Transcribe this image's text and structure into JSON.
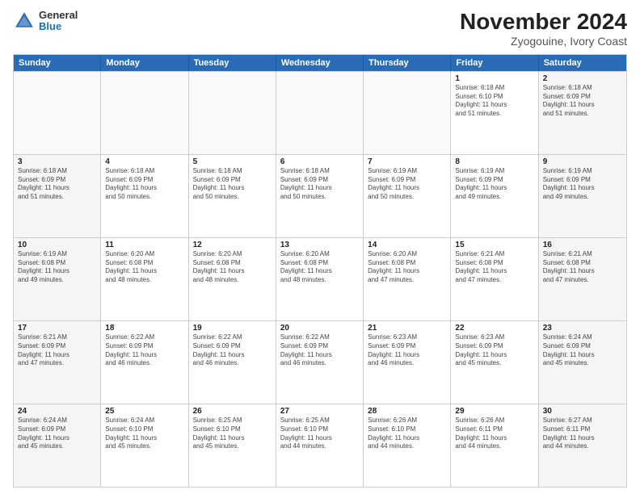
{
  "logo": {
    "general": "General",
    "blue": "Blue"
  },
  "title": "November 2024",
  "subtitle": "Zyogouine, Ivory Coast",
  "header_days": [
    "Sunday",
    "Monday",
    "Tuesday",
    "Wednesday",
    "Thursday",
    "Friday",
    "Saturday"
  ],
  "rows": [
    [
      {
        "day": "",
        "info": "",
        "empty": true
      },
      {
        "day": "",
        "info": "",
        "empty": true
      },
      {
        "day": "",
        "info": "",
        "empty": true
      },
      {
        "day": "",
        "info": "",
        "empty": true
      },
      {
        "day": "",
        "info": "",
        "empty": true
      },
      {
        "day": "1",
        "info": "Sunrise: 6:18 AM\nSunset: 6:10 PM\nDaylight: 11 hours\nand 51 minutes."
      },
      {
        "day": "2",
        "info": "Sunrise: 6:18 AM\nSunset: 6:09 PM\nDaylight: 11 hours\nand 51 minutes."
      }
    ],
    [
      {
        "day": "3",
        "info": "Sunrise: 6:18 AM\nSunset: 6:09 PM\nDaylight: 11 hours\nand 51 minutes."
      },
      {
        "day": "4",
        "info": "Sunrise: 6:18 AM\nSunset: 6:09 PM\nDaylight: 11 hours\nand 50 minutes."
      },
      {
        "day": "5",
        "info": "Sunrise: 6:18 AM\nSunset: 6:09 PM\nDaylight: 11 hours\nand 50 minutes."
      },
      {
        "day": "6",
        "info": "Sunrise: 6:18 AM\nSunset: 6:09 PM\nDaylight: 11 hours\nand 50 minutes."
      },
      {
        "day": "7",
        "info": "Sunrise: 6:19 AM\nSunset: 6:09 PM\nDaylight: 11 hours\nand 50 minutes."
      },
      {
        "day": "8",
        "info": "Sunrise: 6:19 AM\nSunset: 6:09 PM\nDaylight: 11 hours\nand 49 minutes."
      },
      {
        "day": "9",
        "info": "Sunrise: 6:19 AM\nSunset: 6:09 PM\nDaylight: 11 hours\nand 49 minutes."
      }
    ],
    [
      {
        "day": "10",
        "info": "Sunrise: 6:19 AM\nSunset: 6:08 PM\nDaylight: 11 hours\nand 49 minutes."
      },
      {
        "day": "11",
        "info": "Sunrise: 6:20 AM\nSunset: 6:08 PM\nDaylight: 11 hours\nand 48 minutes."
      },
      {
        "day": "12",
        "info": "Sunrise: 6:20 AM\nSunset: 6:08 PM\nDaylight: 11 hours\nand 48 minutes."
      },
      {
        "day": "13",
        "info": "Sunrise: 6:20 AM\nSunset: 6:08 PM\nDaylight: 11 hours\nand 48 minutes."
      },
      {
        "day": "14",
        "info": "Sunrise: 6:20 AM\nSunset: 6:08 PM\nDaylight: 11 hours\nand 47 minutes."
      },
      {
        "day": "15",
        "info": "Sunrise: 6:21 AM\nSunset: 6:08 PM\nDaylight: 11 hours\nand 47 minutes."
      },
      {
        "day": "16",
        "info": "Sunrise: 6:21 AM\nSunset: 6:08 PM\nDaylight: 11 hours\nand 47 minutes."
      }
    ],
    [
      {
        "day": "17",
        "info": "Sunrise: 6:21 AM\nSunset: 6:09 PM\nDaylight: 11 hours\nand 47 minutes."
      },
      {
        "day": "18",
        "info": "Sunrise: 6:22 AM\nSunset: 6:09 PM\nDaylight: 11 hours\nand 46 minutes."
      },
      {
        "day": "19",
        "info": "Sunrise: 6:22 AM\nSunset: 6:09 PM\nDaylight: 11 hours\nand 46 minutes."
      },
      {
        "day": "20",
        "info": "Sunrise: 6:22 AM\nSunset: 6:09 PM\nDaylight: 11 hours\nand 46 minutes."
      },
      {
        "day": "21",
        "info": "Sunrise: 6:23 AM\nSunset: 6:09 PM\nDaylight: 11 hours\nand 46 minutes."
      },
      {
        "day": "22",
        "info": "Sunrise: 6:23 AM\nSunset: 6:09 PM\nDaylight: 11 hours\nand 45 minutes."
      },
      {
        "day": "23",
        "info": "Sunrise: 6:24 AM\nSunset: 6:09 PM\nDaylight: 11 hours\nand 45 minutes."
      }
    ],
    [
      {
        "day": "24",
        "info": "Sunrise: 6:24 AM\nSunset: 6:09 PM\nDaylight: 11 hours\nand 45 minutes."
      },
      {
        "day": "25",
        "info": "Sunrise: 6:24 AM\nSunset: 6:10 PM\nDaylight: 11 hours\nand 45 minutes."
      },
      {
        "day": "26",
        "info": "Sunrise: 6:25 AM\nSunset: 6:10 PM\nDaylight: 11 hours\nand 45 minutes."
      },
      {
        "day": "27",
        "info": "Sunrise: 6:25 AM\nSunset: 6:10 PM\nDaylight: 11 hours\nand 44 minutes."
      },
      {
        "day": "28",
        "info": "Sunrise: 6:26 AM\nSunset: 6:10 PM\nDaylight: 11 hours\nand 44 minutes."
      },
      {
        "day": "29",
        "info": "Sunrise: 6:26 AM\nSunset: 6:11 PM\nDaylight: 11 hours\nand 44 minutes."
      },
      {
        "day": "30",
        "info": "Sunrise: 6:27 AM\nSunset: 6:11 PM\nDaylight: 11 hours\nand 44 minutes."
      }
    ]
  ]
}
